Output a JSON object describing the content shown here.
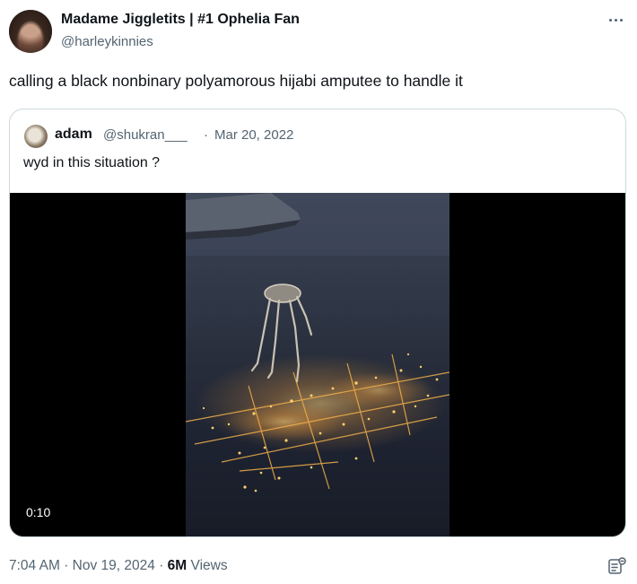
{
  "tweet": {
    "author_name": "Madame Jiggletits | #1 Ophelia Fan",
    "author_handle": "@harleykinnies",
    "text": "calling a black nonbinary polyamorous hijabi amputee to handle it",
    "time": "7:04 AM",
    "date": "Nov 19, 2024",
    "views_count": "6M",
    "views_label": "Views"
  },
  "quoted": {
    "author_name": "adam",
    "author_handle": "@shukran___",
    "separator": "·",
    "date": "Mar 20, 2022",
    "text": "wyd in this situation ?",
    "video": {
      "duration": "0:10"
    }
  },
  "colors": {
    "text_primary": "#0f1419",
    "text_secondary": "#536471",
    "border": "#cfd9de"
  },
  "icons": {
    "more": "more-horizontal-icon",
    "bookmark": "grok-analysis-icon"
  }
}
